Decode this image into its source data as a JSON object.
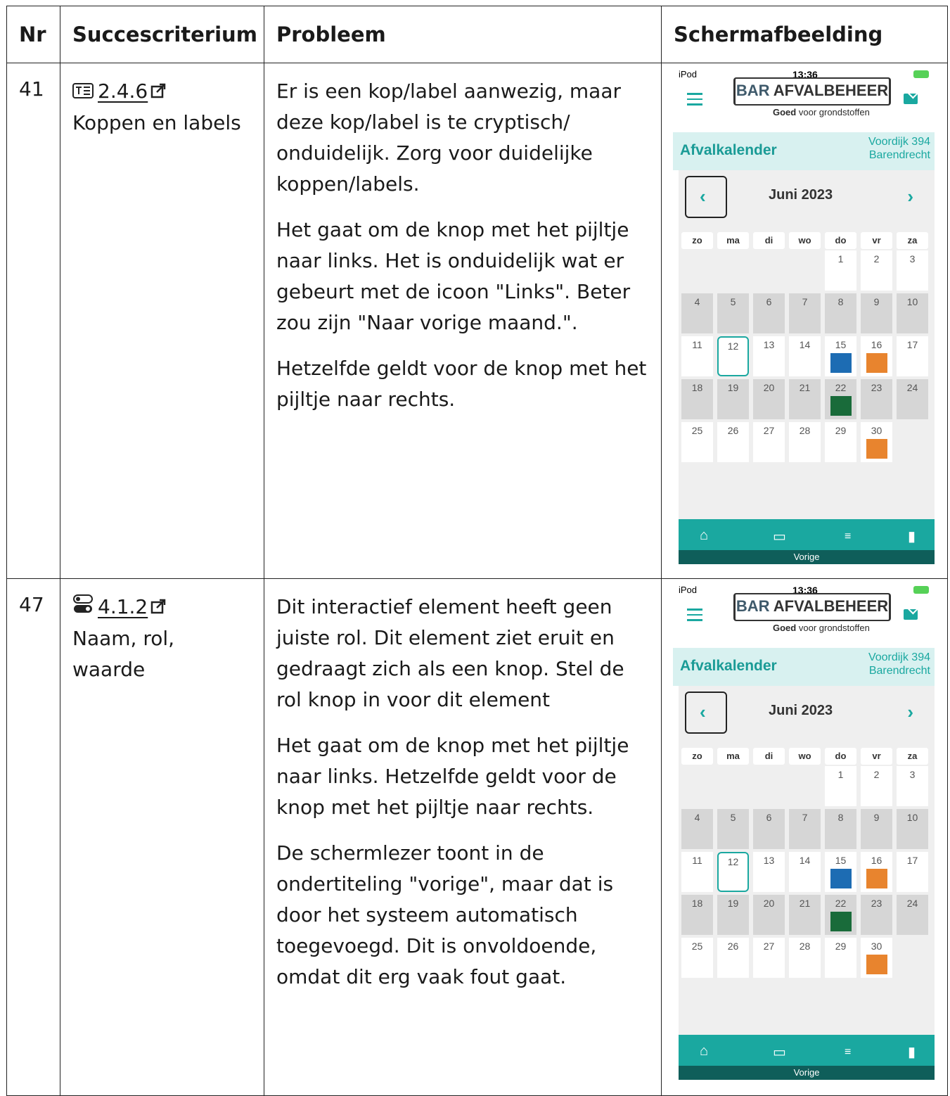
{
  "headers": {
    "nr": "Nr",
    "criterium": "Succescriterium",
    "probleem": "Probleem",
    "screenshot": "Schermafbeelding"
  },
  "rows": [
    {
      "nr": "41",
      "code": "2.4.6",
      "criterium_name": "Koppen en labels",
      "paragraphs": [
        "Er is een kop/label aanwezig, maar deze kop/label is te cryptisch/ onduidelijk. Zorg voor duidelijke koppen/labels.",
        "Het gaat om de knop met het pijltje naar links. Het is onduidelijk wat er gebeurt met de icoon \"Links\". Beter zou zijn \"Naar vorige maand.\".",
        "Hetzelfde geldt voor de knop met het pijltje naar rechts."
      ]
    },
    {
      "nr": "47",
      "code": "4.1.2",
      "criterium_name": "Naam, rol, waarde",
      "paragraphs": [
        "Dit interactief element heeft geen juiste rol. Dit element ziet eruit en gedraagt zich als een knop. Stel de rol knop in voor dit element",
        "Het gaat om de knop met het pijltje naar links. Hetzelfde geldt voor de knop met het pijltje naar rechts.",
        "De schermlezer toont in de ondertiteling \"vorige\", maar dat is door het systeem automatisch toegevoegd. Dit is onvoldoende, omdat dit erg vaak fout gaat."
      ]
    }
  ],
  "phone": {
    "carrier": "iPod",
    "time": "13:36",
    "logo_bar": "BAR",
    "logo_rest": "AFVALBEHEER",
    "tagline_bold": "Goed",
    "tagline_rest": "voor grondstoffen",
    "section_title": "Afvalkalender",
    "address_line1": "Voordijk 394",
    "address_line2": "Barendrecht",
    "month": "Juni 2023",
    "weekdays": [
      "zo",
      "ma",
      "di",
      "wo",
      "do",
      "vr",
      "za"
    ],
    "days": [
      "1",
      "2",
      "3",
      "4",
      "5",
      "6",
      "7",
      "8",
      "9",
      "10",
      "11",
      "12",
      "13",
      "14",
      "15",
      "16",
      "17",
      "18",
      "19",
      "20",
      "21",
      "22",
      "23",
      "24",
      "25",
      "26",
      "27",
      "28",
      "29",
      "30"
    ],
    "subtitle": "Vorige",
    "accent": "#1aa8a0"
  }
}
